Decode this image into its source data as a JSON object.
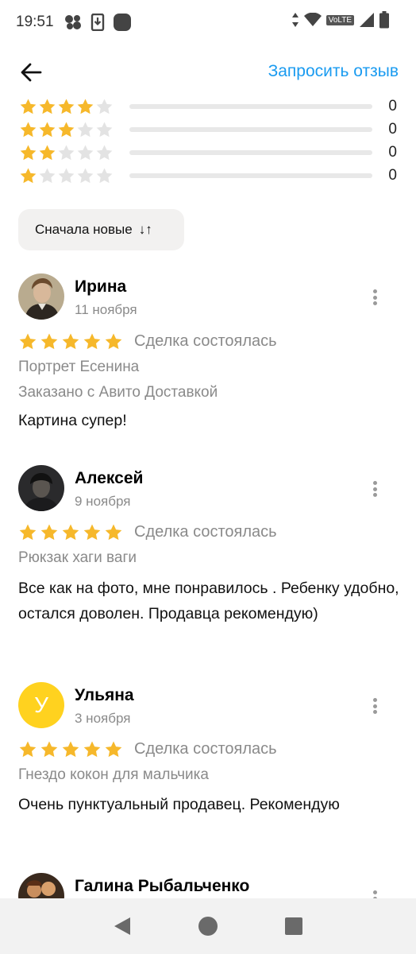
{
  "status_bar": {
    "time": "19:51",
    "network_label": "VoLTE"
  },
  "app_bar": {
    "back_icon": "arrow-left-icon",
    "request_review_label": "Запросить отзыв",
    "accent_color": "#1a9bf0"
  },
  "rating_breakdown": [
    {
      "stars": 4,
      "count": "0"
    },
    {
      "stars": 3,
      "count": "0"
    },
    {
      "stars": 2,
      "count": "0"
    },
    {
      "stars": 1,
      "count": "0"
    }
  ],
  "sort": {
    "label": "Сначала новые",
    "icon": "sort-arrows-icon"
  },
  "star_color": "#f6b82b",
  "reviews": [
    {
      "author": "Ирина",
      "date": "11 ноября",
      "rating": 5,
      "deal_status": "Сделка состоялась",
      "item": "Портрет Есенина",
      "delivery": "Заказано с Авито Доставкой",
      "text": "Картина супер!"
    },
    {
      "author": "Алексей",
      "date": "9 ноября",
      "rating": 5,
      "deal_status": "Сделка состоялась",
      "item": "Рюкзак хаги ваги",
      "text": "Все как на фото, мне понравилось . Ребенку удобно, остался доволен. Продавца рекомендую)"
    },
    {
      "author": "Ульяна",
      "date": "3 ноября",
      "rating": 5,
      "deal_status": "Сделка состоялась",
      "item": "Гнездо кокон для мальчика",
      "text": "Очень пунктуальный продавец. Рекомендую",
      "avatar_letter": "У",
      "avatar_color": "#ffd21f"
    },
    {
      "author": "Галина Рыбальченко"
    }
  ]
}
